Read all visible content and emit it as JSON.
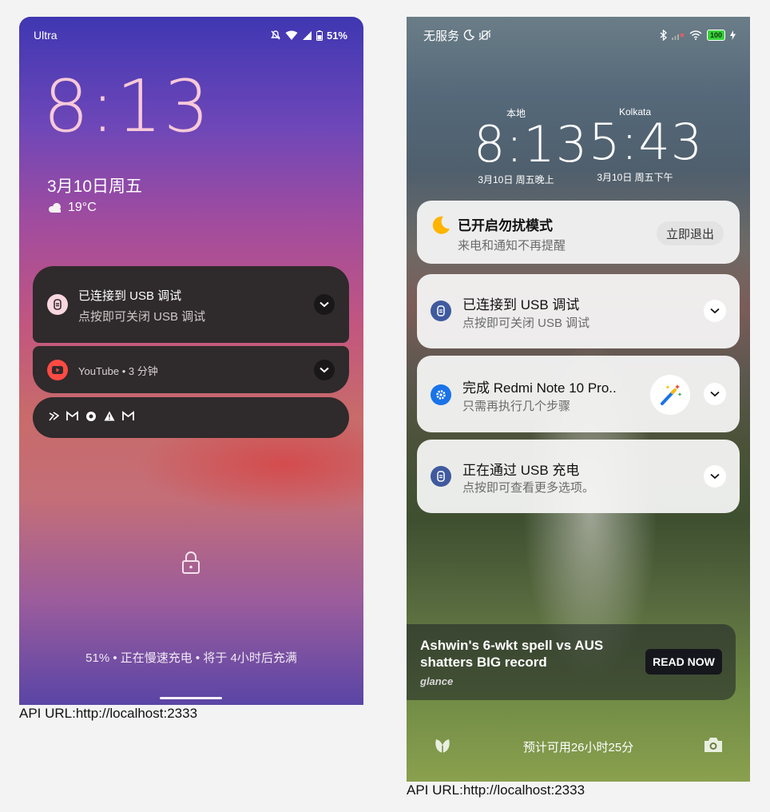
{
  "left": {
    "status": {
      "carrier": "Ultra",
      "battery": "51%"
    },
    "clock": "8:13",
    "date": "3月10日周五",
    "weather": {
      "icon": "cloud-icon",
      "temp": "19°C"
    },
    "notifications": [
      {
        "icon": "usb-icon",
        "title": "已连接到 USB 调试",
        "subtitle": "点按即可关闭 USB 调试"
      },
      {
        "icon": "youtube-icon",
        "title": "YouTube • 3 分钟"
      }
    ],
    "overflow_icons": [
      "nav-icon",
      "gmail-icon",
      "chrome-icon",
      "warning-icon",
      "gmail-icon"
    ],
    "charge_status": "51% • 正在慢速充电 • 将于 4小时后充满"
  },
  "right": {
    "status": {
      "left_text": "无服务",
      "battery": "100"
    },
    "clocks": [
      {
        "city": "本地",
        "time": "8:13",
        "date": "3月10日 周五晚上"
      },
      {
        "city": "Kolkata",
        "time": "5:43",
        "date": "3月10日 周五下午"
      }
    ],
    "dnd": {
      "title": "已开启勿扰模式",
      "subtitle": "来电和通知不再提醒",
      "button": "立即退出"
    },
    "notifications": [
      {
        "icon": "usb-icon",
        "title": "已连接到 USB 调试",
        "subtitle": "点按即可关闭 USB 调试"
      },
      {
        "icon": "gear-icon",
        "title": "完成 Redmi Note 10 Pro..",
        "subtitle": "只需再执行几个步骤"
      },
      {
        "icon": "usb-icon",
        "title": "正在通过 USB 充电",
        "subtitle": "点按即可查看更多选项。"
      }
    ],
    "glance": {
      "headline": "Ashwin's 6-wkt spell vs AUS shatters BIG record",
      "brand": "glance",
      "button": "READ NOW"
    },
    "bottom_text": "预计可用26小时25分"
  },
  "api_url_left": "API URL:http://localhost:2333",
  "api_url_right": "API URL:http://localhost:2333",
  "colors": {
    "left_card": "#2f2a2c",
    "left_clock": "#f7c9d9",
    "usb_icon_left": "#f8d7df",
    "youtube": "#ff4a43",
    "right_icon_blue": "#3f5a9e",
    "settings_blue": "#1a73e8",
    "moon": "#ffb400"
  }
}
